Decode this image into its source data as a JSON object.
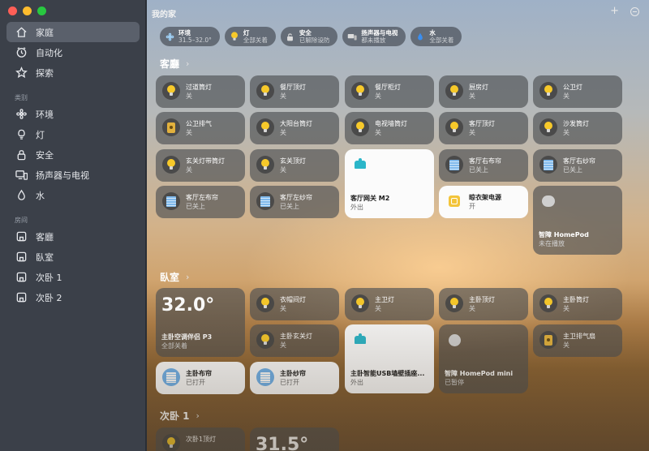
{
  "window": {
    "title": "我的家"
  },
  "sidebar": {
    "main_items": [
      {
        "label": "家庭",
        "icon": "house-icon",
        "active": true
      },
      {
        "label": "自动化",
        "icon": "clock-icon"
      },
      {
        "label": "探索",
        "icon": "star-icon"
      }
    ],
    "categories_header": "类别",
    "categories": [
      {
        "label": "环境",
        "icon": "fan-icon"
      },
      {
        "label": "灯",
        "icon": "lightbulb-icon"
      },
      {
        "label": "安全",
        "icon": "lock-icon"
      },
      {
        "label": "扬声器与电视",
        "icon": "tv-speaker-icon"
      },
      {
        "label": "水",
        "icon": "drop-icon"
      }
    ],
    "rooms_header": "房间",
    "rooms": [
      {
        "label": "客廳",
        "icon": "room-icon"
      },
      {
        "label": "臥室",
        "icon": "room-icon"
      },
      {
        "label": "次卧 1",
        "icon": "room-icon"
      },
      {
        "label": "次卧 2",
        "icon": "room-icon"
      }
    ]
  },
  "toolbar": {
    "add_icon": "plus-icon",
    "more_icon": "more-circle-icon"
  },
  "chips": [
    {
      "title": "环境",
      "subtitle": "31.5–32.0°",
      "icon": "fan-icon"
    },
    {
      "title": "灯",
      "subtitle": "全部关着",
      "icon": "lightbulb-icon"
    },
    {
      "title": "安全",
      "subtitle": "已解除设防",
      "icon": "lock-icon"
    },
    {
      "title": "扬声器与电视",
      "subtitle": "都未播放",
      "icon": "tv-speaker-icon"
    },
    {
      "title": "水",
      "subtitle": "全部关着",
      "icon": "drop-icon"
    }
  ],
  "sections": {
    "living": "客廳",
    "bedroom": "臥室",
    "bedroom2": "次卧 1"
  },
  "living_tiles": [
    {
      "name": "过道筒灯",
      "status": "关"
    },
    {
      "name": "餐厅顶灯",
      "status": "关"
    },
    {
      "name": "餐厅柜灯",
      "status": "关"
    },
    {
      "name": "厨房灯",
      "status": "关"
    },
    {
      "name": "公卫灯",
      "status": "关"
    },
    {
      "name": "公卫排气",
      "status": "关"
    },
    {
      "name": "大阳台筒灯",
      "status": "关"
    },
    {
      "name": "电视墙筒灯",
      "status": "关"
    },
    {
      "name": "客厅顶灯",
      "status": "关"
    },
    {
      "name": "沙发筒灯",
      "status": "关"
    },
    {
      "name": "玄关灯带筒灯",
      "status": "关"
    },
    {
      "name": "玄关顶灯",
      "status": "关"
    },
    {
      "name": "客厅网关 M2",
      "status": "外出"
    },
    {
      "name": "客厅右布帘",
      "status": "已关上"
    },
    {
      "name": "客厅右纱帘",
      "status": "已关上"
    },
    {
      "name": "客厅左布帘",
      "status": "已关上"
    },
    {
      "name": "客厅左纱帘",
      "status": "已关上"
    },
    {
      "name": "晾衣架电源",
      "status": "开"
    },
    {
      "name": "智障 HomePod",
      "status": "未在播放"
    }
  ],
  "bedroom_tiles": [
    {
      "name": "主卧空调伴侣 P3",
      "status": "全部关着",
      "value": "32.0°"
    },
    {
      "name": "衣帽间灯",
      "status": "关"
    },
    {
      "name": "主卫灯",
      "status": "关"
    },
    {
      "name": "主卧顶灯",
      "status": "关"
    },
    {
      "name": "主卧筒灯",
      "status": "关"
    },
    {
      "name": "主卧玄关灯",
      "status": "关"
    },
    {
      "name": "主卧智能USB墙壁插座...",
      "status": "外出"
    },
    {
      "name": "智障 HomePod mini",
      "status": "已暂停"
    },
    {
      "name": "主卫排气扇",
      "status": "关"
    },
    {
      "name": "主卧布帘",
      "status": "已打开"
    },
    {
      "name": "主卧纱帘",
      "status": "已打开"
    }
  ],
  "bedroom2_tiles": [
    {
      "name": "次卧1顶灯",
      "status": ""
    },
    {
      "value": "31.5°"
    }
  ]
}
